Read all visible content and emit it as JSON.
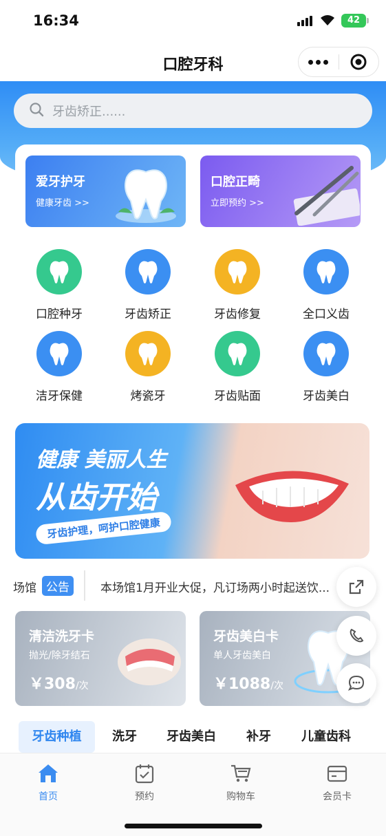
{
  "status": {
    "time": "16:34",
    "battery": "42"
  },
  "nav": {
    "title": "口腔牙科",
    "more_icon": "more-dots-icon",
    "target_icon": "target-icon"
  },
  "search": {
    "placeholder": "牙齿矫正......"
  },
  "banners": [
    {
      "title": "爱牙护牙",
      "sub": "健康牙齿 >>"
    },
    {
      "title": "口腔正畸",
      "sub": "立即预约 >>"
    }
  ],
  "services": [
    {
      "label": "口腔种牙",
      "color": "#35c98e",
      "icon": "implant-tooth-icon"
    },
    {
      "label": "牙齿矫正",
      "color": "#3b8ff2",
      "icon": "tooth-sparkle-icon"
    },
    {
      "label": "牙齿修复",
      "color": "#f4b323",
      "icon": "tooth-repair-icon"
    },
    {
      "label": "全口义齿",
      "color": "#3b8ff2",
      "icon": "dentures-icon"
    },
    {
      "label": "洁牙保健",
      "color": "#3b8ff2",
      "icon": "toothbrush-icon"
    },
    {
      "label": "烤瓷牙",
      "color": "#f4b323",
      "icon": "porcelain-tooth-icon"
    },
    {
      "label": "牙齿贴面",
      "color": "#35c98e",
      "icon": "veneer-tooth-icon"
    },
    {
      "label": "牙齿美白",
      "color": "#3b8ff2",
      "icon": "whitening-tooth-icon"
    }
  ],
  "promo": {
    "line1": "健康 美丽人生",
    "line2": "从齿开始",
    "pill": "牙齿护理，呵护口腔健康"
  },
  "notice": {
    "label": "场馆",
    "badge": "公告",
    "text": "本场馆1月开业大促，凡订场两小时起送饮..."
  },
  "cards": [
    {
      "title": "清洁洗牙卡",
      "sub": "抛光/除牙结石",
      "price": "￥308",
      "unit": "/次"
    },
    {
      "title": "牙齿美白卡",
      "sub": "单人牙齿美白",
      "price": "￥1088",
      "unit": "/次"
    }
  ],
  "category_tabs": [
    "牙齿种植",
    "洗牙",
    "牙齿美白",
    "补牙",
    "儿童齿科"
  ],
  "tabbar": [
    {
      "label": "首页",
      "icon": "home-icon"
    },
    {
      "label": "预约",
      "icon": "calendar-check-icon"
    },
    {
      "label": "购物车",
      "icon": "cart-icon"
    },
    {
      "label": "会员卡",
      "icon": "member-card-icon"
    }
  ],
  "colors": {
    "primary": "#3b8cf0",
    "green": "#35c98e",
    "orange": "#f4b323"
  }
}
